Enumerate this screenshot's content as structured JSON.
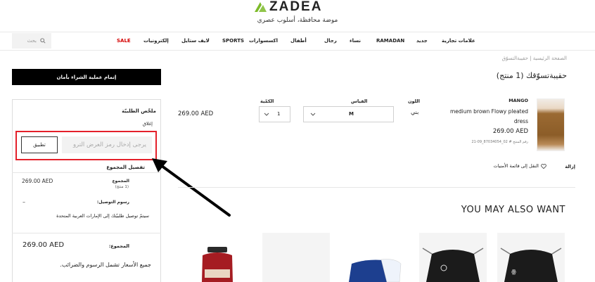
{
  "header": {
    "logo_text": "ZADEA",
    "tagline": "موضة محافظة، أسلوب عصري",
    "search_placeholder": "بحث",
    "nav": [
      {
        "label": "علامات تجارية"
      },
      {
        "label": "جديد"
      },
      {
        "label": "RAMADAN"
      },
      {
        "label": "نساء"
      },
      {
        "label": "رجال"
      },
      {
        "label": "أطفال"
      },
      {
        "label": "اكسسوارات"
      },
      {
        "label": "SPORTS"
      },
      {
        "label": "لايف ستايل"
      },
      {
        "label": "إلكترونيات"
      },
      {
        "label": "SALE"
      }
    ]
  },
  "breadcrumb": "الصفحة الرئيسية | حقيبةالتسوّق",
  "page_title": "حقيبةتسوّقك (1 منتج)",
  "checkout_label": "إتمام عملية الشراء بأمان",
  "summary": {
    "title": "ملخّص الطلبيّة",
    "close_label": "إغلاق",
    "apply_label": "تطبيق",
    "promo_placeholder": "يرجى إدخال رمز العرض الترو",
    "details_label": "تفصيل المجموع",
    "subtotal_label": "المجموع",
    "subtotal_count": "(1 منتج)",
    "subtotal_value": "269.00 AED",
    "shipping_label": "رسوم التوصيل:",
    "shipping_value": "–",
    "shipping_note": "سيتمّ توصيل طلبيّتك إلى الإمارات العربية المتحدة",
    "total_label": "المجموع:",
    "total_value": "269.00 AED",
    "tax_note": "جميع الأسعار تشمل الرسوم والضرائب."
  },
  "product": {
    "brand": "MANGO",
    "name": "medium brown Flowy pleated dress",
    "price": "269.00 AED",
    "code": "رقم المنتج # 02_87034054_09-21",
    "color_label": "اللون",
    "color_value": "بني",
    "size_label": "القياس",
    "size_value": "M",
    "qty_label": "الكمّية",
    "qty_value": "1",
    "line_price": "269.00 AED",
    "move_to_wishlist": "النقل إلى قائمة الأمنيات",
    "remove_label": "إزالة"
  },
  "recommendations_title": "YOU MAY ALSO WANT",
  "colors": {
    "sale": "#d40000",
    "highlight_box": "#e4202a",
    "logo_green": "#7dbb2a",
    "checkout_bg": "#000000"
  }
}
